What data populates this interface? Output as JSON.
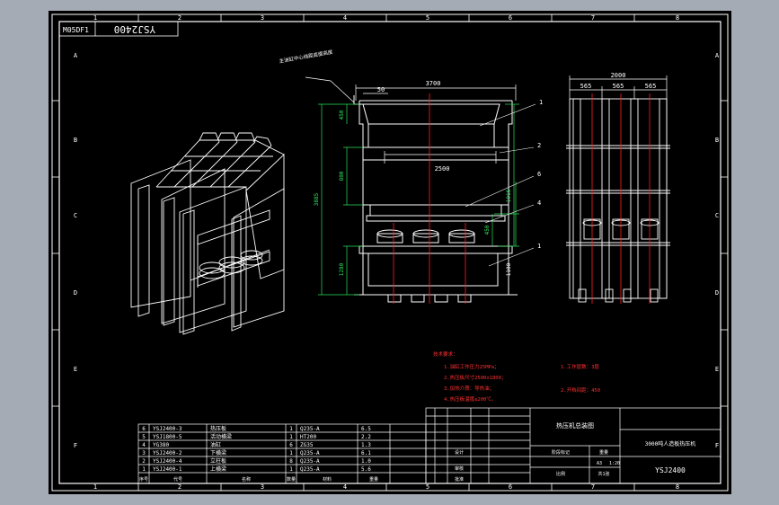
{
  "drawing": {
    "rotated_code": "YSJ2400",
    "code_label": "M05DF1",
    "col_marks": [
      "1",
      "2",
      "3",
      "4",
      "5",
      "6",
      "7",
      "8"
    ],
    "row_marks": [
      "A",
      "B",
      "C",
      "D",
      "E",
      "F"
    ]
  },
  "front_view": {
    "overall_width": "3700",
    "left_offset": "50",
    "inner_width": "2500",
    "callouts": [
      "1",
      "2",
      "6",
      "4",
      "1"
    ],
    "height_total": "3885",
    "height_right_top": "1016",
    "height_right_mid": "450",
    "height_right_bottom": "1100",
    "height_left_a": "450",
    "height_left_b": "800",
    "height_left_c": "1280",
    "note": "主油缸中心线距底面高度"
  },
  "side_view": {
    "overall_width": "2000",
    "bays": [
      "565",
      "565",
      "565"
    ]
  },
  "tech_requirements": {
    "title": "技术要求：",
    "lines": [
      "1.油缸工作压力25MPa；",
      "2.热压板尺寸2500x1800；",
      "3.加热介质：导热油；",
      "4.热压板温度≤200℃。"
    ],
    "notes": [
      "1.工作层数：3层",
      "2.开档间距：450"
    ]
  },
  "parts_table": {
    "rows": [
      {
        "no": "6",
        "code": "YSJ2400-3",
        "name": "热压板",
        "qty": "1",
        "material": "Q235-A",
        "mass": "6.5"
      },
      {
        "no": "5",
        "code": "YSJ1800-5",
        "name": "活动横梁",
        "qty": "1",
        "material": "HT200",
        "mass": "2.2"
      },
      {
        "no": "4",
        "code": "YG380",
        "name": "油缸",
        "qty": "6",
        "material": "ZG35",
        "mass": "1.3"
      },
      {
        "no": "3",
        "code": "YSJ2400-2",
        "name": "下横梁",
        "qty": "1",
        "material": "Q235-A",
        "mass": "6.1"
      },
      {
        "no": "2",
        "code": "YSJ2400-4",
        "name": "立柱板",
        "qty": "8",
        "material": "Q235-A",
        "mass": "1.0"
      },
      {
        "no": "1",
        "code": "YSJ2400-1",
        "name": "上横梁",
        "qty": "1",
        "material": "Q235-A",
        "mass": "5.6"
      }
    ],
    "header": {
      "no": "序号",
      "code": "代号",
      "name": "名称",
      "qty": "数量",
      "material": "材料",
      "mass": "重量"
    }
  },
  "title_block": {
    "product_name": "热压机总装图",
    "company": "3000吨人造板热压机",
    "drawing_number": "YSJ2400",
    "scale": "1:20",
    "sheet": "共1张",
    "designer": "设计",
    "checker": "审核",
    "approve": "批准",
    "stage": "阶段标记",
    "weight": "重量",
    "ratio": "比例",
    "size": "A3"
  }
}
